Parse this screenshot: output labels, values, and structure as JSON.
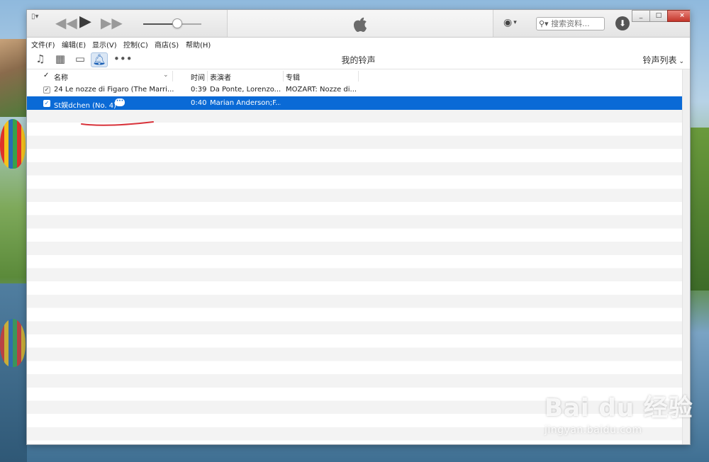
{
  "titlebar": {
    "search_placeholder": "搜索资料...",
    "window_buttons": [
      "_",
      "□",
      "×"
    ]
  },
  "menubar": {
    "items": [
      "文件(F)",
      "编辑(E)",
      "显示(V)",
      "控制(C)",
      "商店(S)",
      "帮助(H)"
    ]
  },
  "toolbar": {
    "page_title": "我的铃声",
    "view_menu_label": "铃声列表",
    "icons": [
      "music-note-icon",
      "film-icon",
      "tv-icon",
      "bell-icon",
      "more-icon"
    ]
  },
  "table": {
    "headers": {
      "check": "✓",
      "name": "名称",
      "time": "时间",
      "artist": "表演者",
      "album": "专辑"
    },
    "rows": [
      {
        "checked": "✓",
        "name": "24  Le nozze di Figaro (The Marri...",
        "time": "0:39",
        "artist": "Da Ponte, Lorenzo...",
        "album": "MOZART: Nozze di...",
        "selected": false
      },
      {
        "checked": "✓",
        "name": "St娱dchen (No. 4)",
        "time": "0:40",
        "artist": "Marian  Anderson;F...",
        "album": "",
        "selected": true
      }
    ]
  },
  "watermark": {
    "brand": "Bai du 经验",
    "url": "jingyan.baidu.com"
  },
  "colors": {
    "selection": "#0a6ad6",
    "annotation_underline": "#d8323a"
  }
}
